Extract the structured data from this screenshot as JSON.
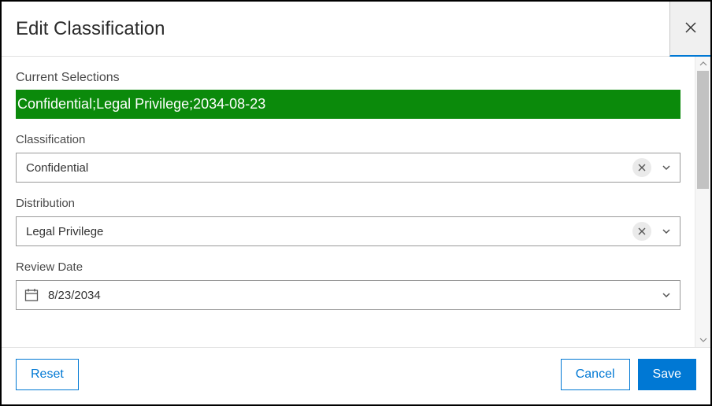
{
  "dialog": {
    "title": "Edit Classification"
  },
  "fields": {
    "current_selections_label": "Current Selections",
    "current_selections_value": "Confidential;Legal Privilege;2034-08-23",
    "classification": {
      "label": "Classification",
      "value": "Confidential"
    },
    "distribution": {
      "label": "Distribution",
      "value": "Legal Privilege"
    },
    "review_date": {
      "label": "Review Date",
      "value": "8/23/2034"
    }
  },
  "buttons": {
    "reset": "Reset",
    "cancel": "Cancel",
    "save": "Save"
  },
  "colors": {
    "selections_bg": "#0b8a0b",
    "primary": "#0078d4"
  }
}
